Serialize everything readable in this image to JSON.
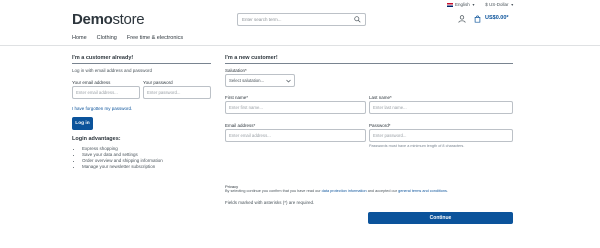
{
  "topbar": {
    "language": "English",
    "currency": "$ US-Dollar"
  },
  "logo": {
    "bold": "Demo",
    "light": "store"
  },
  "search": {
    "placeholder": "Enter search term..."
  },
  "header": {
    "cart_total": "US$0.00*"
  },
  "nav": {
    "items": [
      "Home",
      "Clothing",
      "Free time & electronics"
    ]
  },
  "login": {
    "title": "I'm a customer already!",
    "intro": "Log in with email address and password",
    "email_label": "Your email address",
    "email_placeholder": "Enter email address...",
    "password_label": "Your password",
    "password_placeholder": "Enter password...",
    "forgot_link": "I have forgotten my password.",
    "login_button": "Log in",
    "advantages_title": "Login advantages:",
    "advantages": [
      "Express shopping",
      "Save your data and settings",
      "Order overview and shipping information",
      "Manage your newsletter subscription"
    ]
  },
  "register": {
    "title": "I'm a new customer!",
    "salutation_label": "Salutation*",
    "salutation_value": "Select salutation...",
    "first_name_label": "First name*",
    "first_name_placeholder": "Enter first name...",
    "last_name_label": "Last name*",
    "last_name_placeholder": "Enter last name...",
    "email_label": "Email address*",
    "email_placeholder": "Enter email address...",
    "password_label": "Password*",
    "password_placeholder": "Enter password...",
    "password_hint": "Passwords must have a minimum length of 8 characters.",
    "privacy_title": "Privacy",
    "privacy_text_1": "By selecting continue you confirm that you have read our ",
    "privacy_link_1": "data protection information",
    "privacy_text_2": " and accepted our ",
    "privacy_link_2": "general terms and conditions",
    "privacy_text_3": ".",
    "required_note": "Fields marked with asterisks (*) are required.",
    "continue_button": "Continue"
  }
}
